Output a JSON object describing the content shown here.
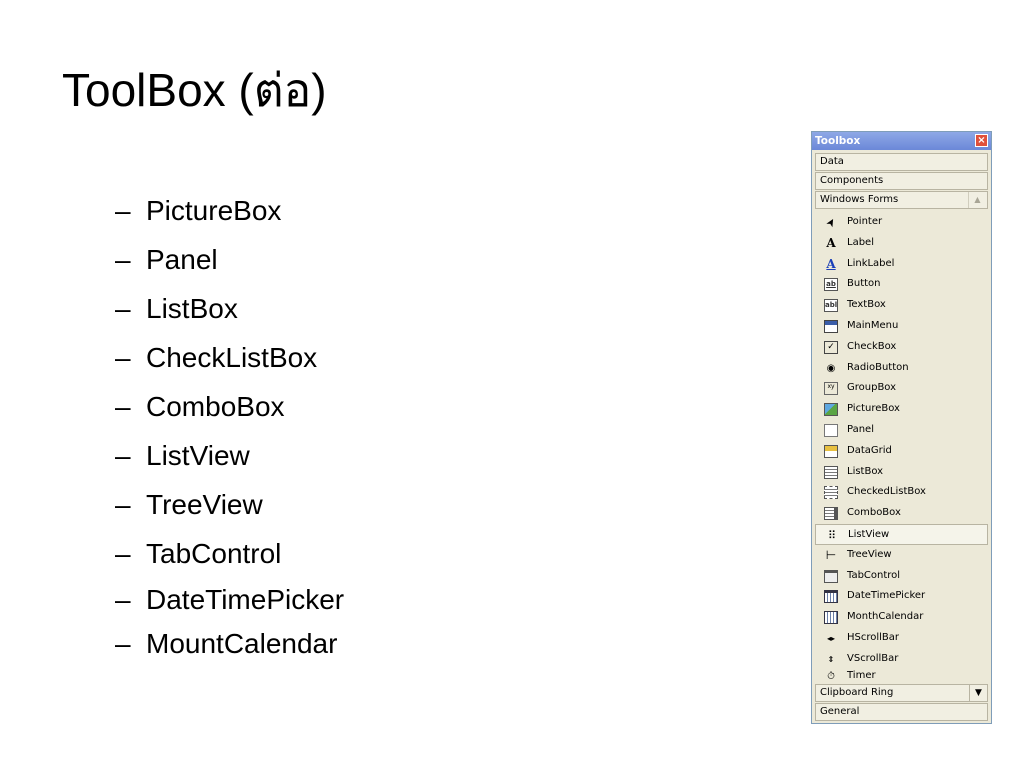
{
  "slide": {
    "title": "ToolBox (ต่อ)",
    "bullets": [
      "PictureBox",
      "Panel",
      "ListBox",
      "CheckListBox",
      "ComboBox",
      "ListView",
      "TreeView",
      "TabControl",
      "DateTimePicker",
      "MountCalendar"
    ],
    "dash": "–"
  },
  "toolbox": {
    "title": "Toolbox",
    "close_glyph": "×",
    "tabs": [
      "Data",
      "Components",
      "Windows Forms"
    ],
    "scroll_up_glyph": "▲",
    "items": [
      {
        "label": "Pointer",
        "icon": "pointer-icon",
        "glyph": "➤"
      },
      {
        "label": "Label",
        "icon": "label-icon",
        "glyph": "A"
      },
      {
        "label": "LinkLabel",
        "icon": "linklabel-icon",
        "glyph": "A"
      },
      {
        "label": "Button",
        "icon": "button-icon",
        "glyph": "ab"
      },
      {
        "label": "TextBox",
        "icon": "textbox-icon",
        "glyph": "abl"
      },
      {
        "label": "MainMenu",
        "icon": "mainmenu-icon",
        "glyph": ""
      },
      {
        "label": "CheckBox",
        "icon": "checkbox-icon",
        "glyph": "✓"
      },
      {
        "label": "RadioButton",
        "icon": "radiobutton-icon",
        "glyph": "◉"
      },
      {
        "label": "GroupBox",
        "icon": "groupbox-icon",
        "glyph": "xy"
      },
      {
        "label": "PictureBox",
        "icon": "picturebox-icon",
        "glyph": ""
      },
      {
        "label": "Panel",
        "icon": "panel-icon",
        "glyph": ""
      },
      {
        "label": "DataGrid",
        "icon": "datagrid-icon",
        "glyph": ""
      },
      {
        "label": "ListBox",
        "icon": "listbox-icon",
        "glyph": ""
      },
      {
        "label": "CheckedListBox",
        "icon": "checkedlistbox-icon",
        "glyph": ""
      },
      {
        "label": "ComboBox",
        "icon": "combobox-icon",
        "glyph": ""
      },
      {
        "label": "ListView",
        "icon": "listview-icon",
        "glyph": "⠿"
      },
      {
        "label": "TreeView",
        "icon": "treeview-icon",
        "glyph": "⊢"
      },
      {
        "label": "TabControl",
        "icon": "tabcontrol-icon",
        "glyph": ""
      },
      {
        "label": "DateTimePicker",
        "icon": "datetimepicker-icon",
        "glyph": ""
      },
      {
        "label": "MonthCalendar",
        "icon": "monthcalendar-icon",
        "glyph": ""
      },
      {
        "label": "HScrollBar",
        "icon": "hscrollbar-icon",
        "glyph": "◂▸"
      },
      {
        "label": "VScrollBar",
        "icon": "vscrollbar-icon",
        "glyph": "⇕"
      },
      {
        "label": "Timer",
        "icon": "timer-icon",
        "glyph": "⏱"
      }
    ],
    "selected_item": "ListView",
    "bottom_tabs": [
      "Clipboard Ring",
      "General"
    ],
    "dropdown_glyph": "▼"
  },
  "colors": {
    "title_bar": "#7a96df",
    "panel_bg": "#ece9d8",
    "close_button": "#e0503a",
    "link_blue": "#1a3fb8"
  }
}
